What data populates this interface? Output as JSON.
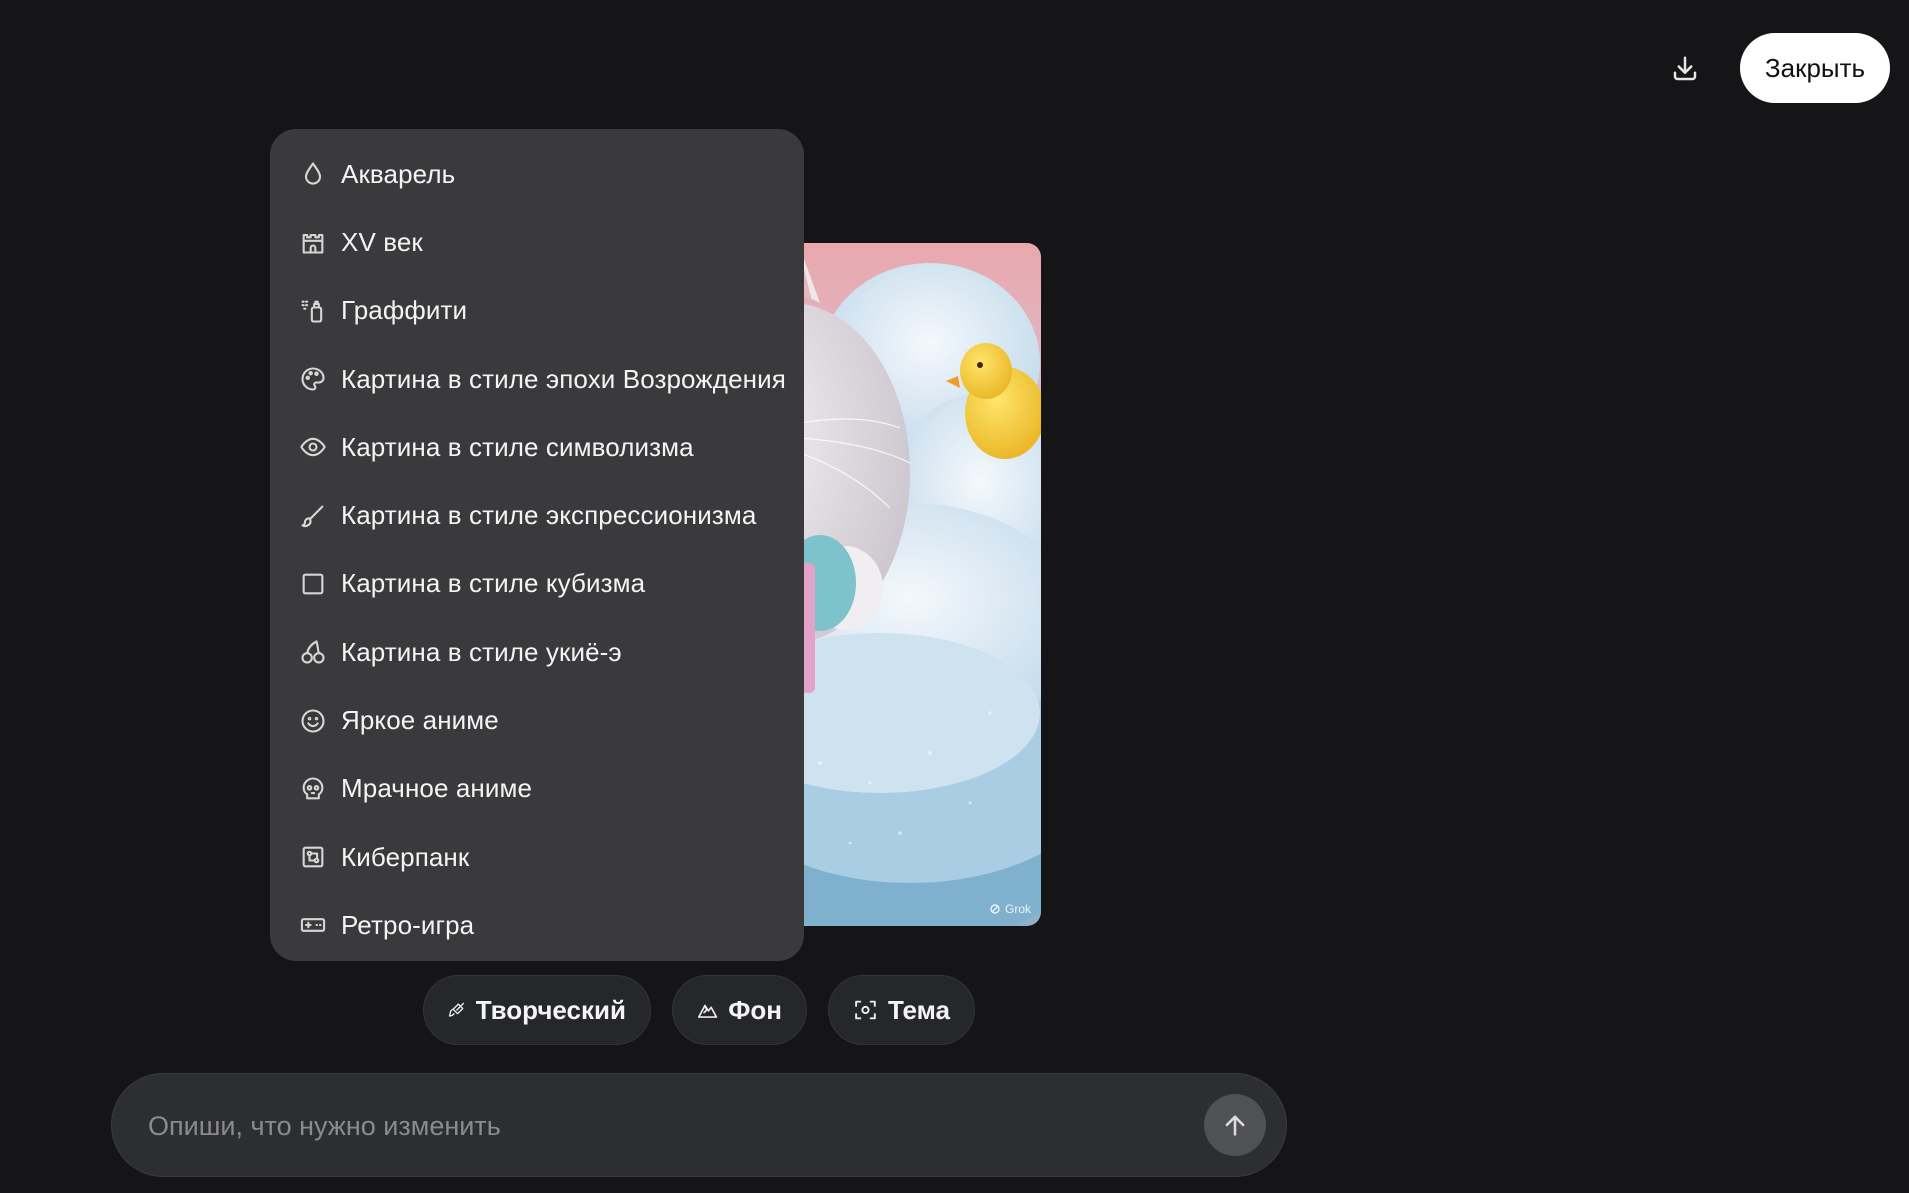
{
  "header": {
    "download_icon": "download-icon",
    "close_label": "Закрыть"
  },
  "preview": {
    "watermark": "Grok"
  },
  "style_menu": {
    "items": [
      {
        "label": "Акварель",
        "icon": "drop-icon"
      },
      {
        "label": "XV век",
        "icon": "castle-icon"
      },
      {
        "label": "Граффити",
        "icon": "spray-can-icon"
      },
      {
        "label": "Картина в стиле эпохи Возрождения",
        "icon": "palette-icon"
      },
      {
        "label": "Картина в стиле символизма",
        "icon": "eye-icon"
      },
      {
        "label": "Картина в стиле экспрессионизма",
        "icon": "paintbrush-icon"
      },
      {
        "label": "Картина в стиле кубизма",
        "icon": "square-icon"
      },
      {
        "label": "Картина в стиле укиё-э",
        "icon": "cherries-icon"
      },
      {
        "label": "Яркое аниме",
        "icon": "smiley-icon"
      },
      {
        "label": "Мрачное аниме",
        "icon": "skull-icon"
      },
      {
        "label": "Киберпанк",
        "icon": "circuit-icon"
      },
      {
        "label": "Ретро-игра",
        "icon": "gamepad-icon"
      }
    ]
  },
  "chips": {
    "creative": "Творческий",
    "background": "Фон",
    "theme": "Тема"
  },
  "prompt": {
    "placeholder": "Опиши, что нужно изменить",
    "value": ""
  },
  "colors": {
    "page_bg": "#151517",
    "menu_bg": "#3a3a3d",
    "chip_bg": "#26272a",
    "input_bg": "#2d2e31",
    "close_bg": "#ffffff"
  }
}
